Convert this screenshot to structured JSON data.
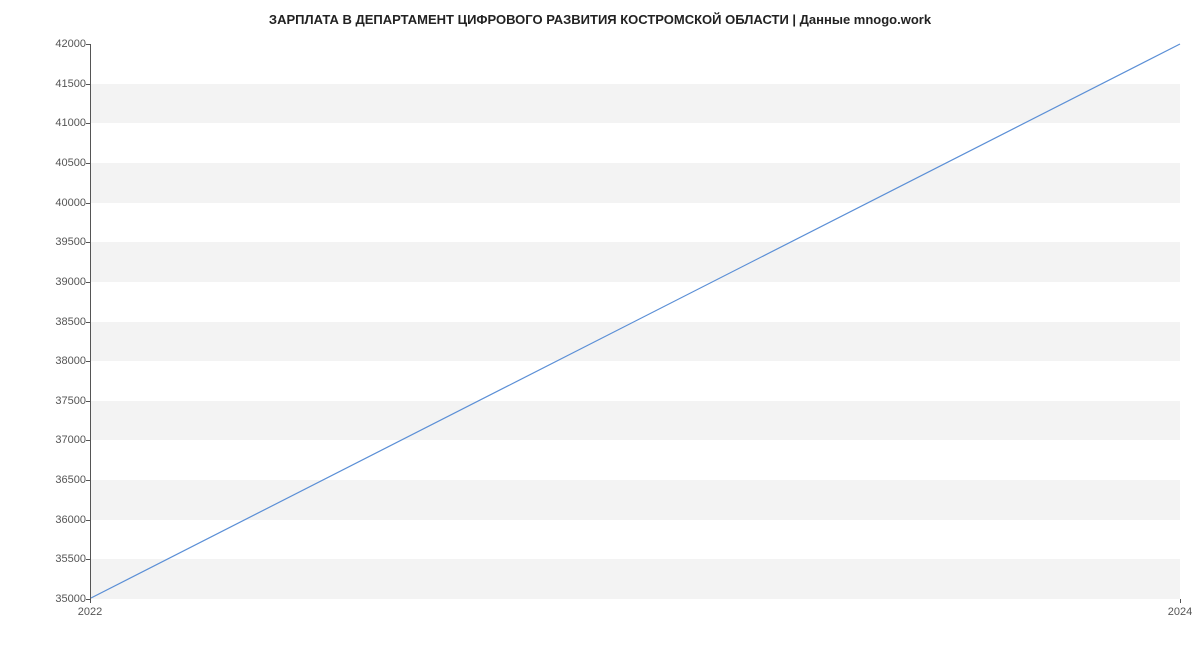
{
  "chart_data": {
    "type": "line",
    "title": "ЗАРПЛАТА В ДЕПАРТАМЕНТ ЦИФРОВОГО РАЗВИТИЯ КОСТРОМСКОЙ ОБЛАСТИ | Данные mnogo.work",
    "x": [
      2022,
      2024
    ],
    "values": [
      35000,
      42000
    ],
    "xlabel": "",
    "ylabel": "",
    "x_ticks": [
      2022,
      2024
    ],
    "y_ticks": [
      35000,
      35500,
      36000,
      36500,
      37000,
      37500,
      38000,
      38500,
      39000,
      39500,
      40000,
      40500,
      41000,
      41500,
      42000
    ],
    "xlim": [
      2022,
      2024
    ],
    "ylim": [
      35000,
      42000
    ],
    "line_color": "#5b8fd6",
    "band_color": "#f3f3f3"
  }
}
